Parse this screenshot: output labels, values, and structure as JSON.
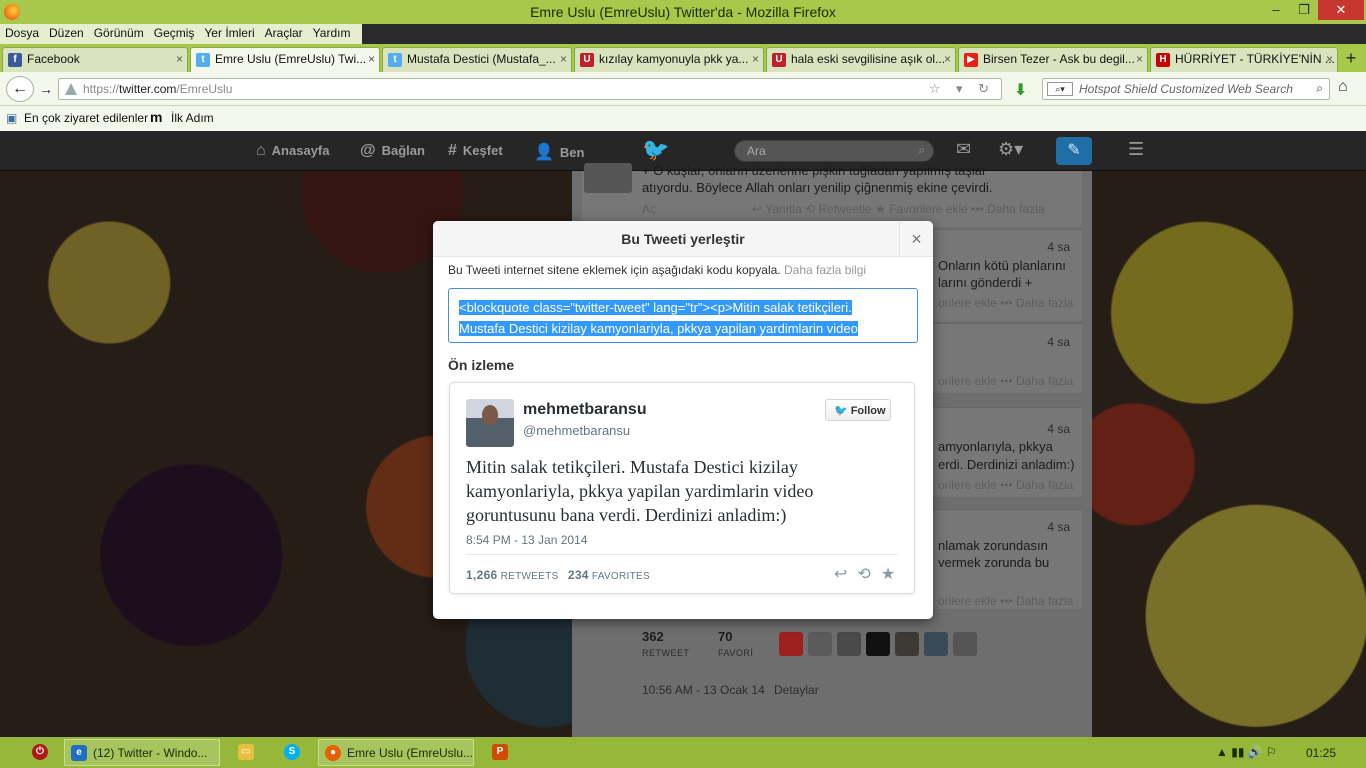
{
  "window": {
    "title": "Emre Uslu (EmreUslu) Twitter'da - Mozilla Firefox",
    "min_glyph": "–",
    "max_glyph": "❐",
    "close_glyph": "✕"
  },
  "menu": [
    "Dosya",
    "Düzen",
    "Görünüm",
    "Geçmiş",
    "Yer İmleri",
    "Araçlar",
    "Yardım"
  ],
  "tabs": [
    {
      "label": "Facebook",
      "icon": "facebook-icon",
      "color": "#3b5998",
      "glyph": "f"
    },
    {
      "label": "Emre Uslu (EmreUslu) Twi...",
      "icon": "twitter-icon",
      "color": "#55acee",
      "glyph": "t"
    },
    {
      "label": "Mustafa Destici (Mustafa_...",
      "icon": "twitter-icon",
      "color": "#55acee",
      "glyph": "t"
    },
    {
      "label": "kızılay kamyonuyla pkk ya...",
      "icon": "u-site-icon",
      "color": "#c0202a",
      "glyph": "U"
    },
    {
      "label": "hala eski sevgilisine aşık ol...",
      "icon": "u-site-icon",
      "color": "#c0202a",
      "glyph": "U"
    },
    {
      "label": "Birsen Tezer - Ask bu degil...",
      "icon": "youtube-icon",
      "color": "#e62117",
      "glyph": "▶"
    },
    {
      "label": "HÜRRİYET - TÜRKİYE'NİN ...",
      "icon": "hurriyet-icon",
      "color": "#cc0000",
      "glyph": "H"
    }
  ],
  "tab_close_glyph": "×",
  "new_tab_glyph": "+",
  "nav": {
    "back_glyph": "←",
    "forward_glyph": "→",
    "url_scheme": "https://",
    "url_host": "twitter.com",
    "url_path": "/EmreUslu",
    "url_right_glyphs": "☆ ▾ ↻",
    "download_glyph": "⬇",
    "search_placeholder": "Hotspot Shield Customized Web Search",
    "search_glyph": "⌕",
    "home_glyph": "⌂"
  },
  "bookmarks": {
    "most_visited": "En çok ziyaret edilenler",
    "first_steps": "İlk Adım"
  },
  "twitter_nav": {
    "home": "Anasayfa",
    "connect": "Bağlan",
    "discover": "Keşfet",
    "me": "Ben",
    "search_placeholder": "Ara",
    "search_glyph": "⌕"
  },
  "timeline": {
    "card1_line1": "+ O kuşlar, onların üzerlerine pişkin tuğladan yapılmış taşlar",
    "card1_line2": "atıyordu.  Böylece Allah onları yenilip çiğnenmiş ekine çevirdi.",
    "card1_open": "Aç",
    "card1_actions": "↩ Yanıtla   ⟲ Retweetle   ★ Favorilere ekle   ••• Daha fazla",
    "card2_time": "4 sa",
    "card2_line1": "Onların kötü planlarını",
    "card2_line2": "larını gönderdi +",
    "card2_actions": "orilere ekle   ••• Daha fazla",
    "card3_time": "4 sa",
    "card3_actions": "orilere ekle   ••• Daha fazla",
    "card4_time": "4 sa",
    "card4_line1": "amyonlarıyla, pkkya",
    "card4_line2": "erdi. Derdinizi anladim:)",
    "card4_actions": "orilere ekle   ••• Daha fazla",
    "card5_time": "4 sa",
    "card5_line1": "nlamak zorundasın",
    "card5_line2": "vermek zorunda bu",
    "card5_actions": "orilere ekle   ••• Daha fazla",
    "retweet_count": "362",
    "retweet_label": "RETWEET",
    "favorite_count": "70",
    "favorite_label": "FAVORİ",
    "timestamp": "10:56 AM - 13 Ocak 14",
    "details": "Detaylar"
  },
  "modal": {
    "title": "Bu Tweeti yerleştir",
    "close_glyph": "×",
    "instruction": "Bu Tweeti internet sitene eklemek için aşağıdaki kodu kopyala.",
    "more_info": "Daha fazla bilgi",
    "code_line1": "<blockquote class=\"twitter-tweet\" lang=\"tr\"><p>Mitin salak tetikçileri.",
    "code_line2": "Mustafa Destici kizilay kamyonlariyla, pkkya yapilan yardimlarin video",
    "preview_heading": "Ön izleme",
    "tweet": {
      "name": "mehmetbaransu",
      "handle": "@mehmetbaransu",
      "follow_label": "Follow",
      "follow_glyph": "🐦",
      "text": "Mitin salak tetikçileri. Mustafa Destici kizilay kamyonlariyla, pkkya yapilan yardimlarin video goruntusunu bana verdi. Derdinizi anladim:)",
      "date": "8:54 PM - 13 Jan 2014",
      "retweets_count": "1,266",
      "retweets_label": "RETWEETS",
      "favorites_count": "234",
      "favorites_label": "FAVORITES",
      "reply_glyph": "↩",
      "retweet_glyph": "⟲",
      "favorite_glyph": "★"
    }
  },
  "taskbar": {
    "item_twitter": "(12) Twitter - Windo...",
    "item_firefox": "Emre Uslu (EmreUslu...",
    "tray_glyphs": "▲ ▮▮ 🔊 ⚐",
    "clock": "01:25"
  }
}
